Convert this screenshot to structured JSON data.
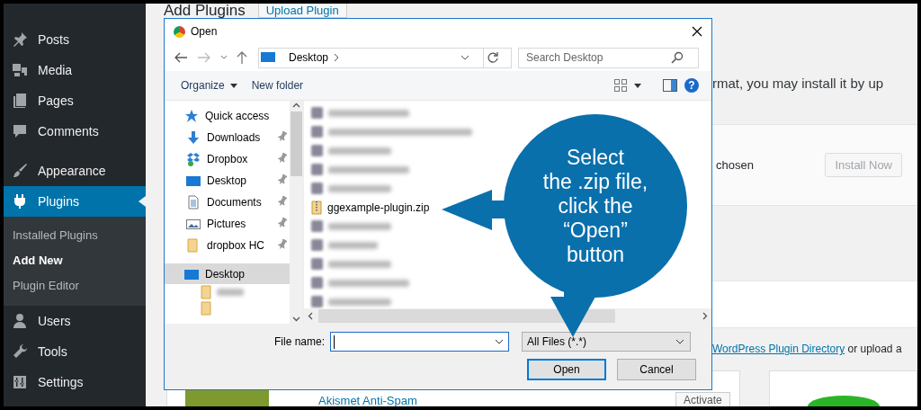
{
  "sidebar": {
    "groups": [
      [
        {
          "label": "Posts",
          "kind": "pin",
          "selected": false
        },
        {
          "label": "Media",
          "kind": "media",
          "selected": false
        },
        {
          "label": "Pages",
          "kind": "pages",
          "selected": false
        },
        {
          "label": "Comments",
          "kind": "comments",
          "selected": false
        }
      ],
      [
        {
          "label": "Appearance",
          "kind": "brush",
          "selected": false
        },
        {
          "label": "Plugins",
          "kind": "plug",
          "selected": true,
          "children": [
            {
              "label": "Installed Plugins",
              "selected": false
            },
            {
              "label": "Add New",
              "selected": true
            },
            {
              "label": "Plugin Editor",
              "selected": false
            }
          ]
        },
        {
          "label": "Users",
          "kind": "user",
          "selected": false
        },
        {
          "label": "Tools",
          "kind": "wrench",
          "selected": false
        },
        {
          "label": "Settings",
          "kind": "sliders",
          "selected": false
        }
      ]
    ]
  },
  "main": {
    "title": "Add Plugins",
    "upload_button": "Upload Plugin",
    "intro_fragment": "rmat, you may install it by up",
    "file_status": "chosen",
    "install_button": {
      "label": "Install Now",
      "disabled": true
    },
    "directory_link": "WordPress Plugin Directory",
    "directory_text": "or upload a",
    "plugin_card": {
      "name": "Akismet Anti-Spam",
      "action": "Activate"
    }
  },
  "dialog": {
    "title": "Open",
    "address": "Desktop",
    "search": {
      "placeholder": "Search Desktop"
    },
    "toolbar": {
      "organize": "Organize",
      "new_folder": "New folder",
      "help": "?"
    },
    "nav_items": [
      {
        "label": "Quick access",
        "kind": "star",
        "pinned": false,
        "selected": false
      },
      {
        "label": "Downloads",
        "kind": "download",
        "pinned": true,
        "selected": false
      },
      {
        "label": "Dropbox",
        "kind": "dropbox",
        "pinned": true,
        "selected": false
      },
      {
        "label": "Desktop",
        "kind": "desktop",
        "pinned": true,
        "selected": false
      },
      {
        "label": "Documents",
        "kind": "document",
        "pinned": true,
        "selected": false
      },
      {
        "label": "Pictures",
        "kind": "picture",
        "pinned": true,
        "selected": false
      },
      {
        "label": "dropbox HC",
        "kind": "folder",
        "pinned": true,
        "selected": false
      },
      {
        "label": "Desktop",
        "kind": "root",
        "pinned": false,
        "selected": true,
        "children": [
          {
            "kind": "blurred"
          },
          {
            "kind": "blurred"
          }
        ]
      }
    ],
    "files": [
      {
        "kind": "blurred"
      },
      {
        "kind": "blurred"
      },
      {
        "kind": "blurred"
      },
      {
        "kind": "blurred"
      },
      {
        "kind": "blurred"
      },
      {
        "kind": "zip",
        "name": "ggexample-plugin.zip"
      },
      {
        "kind": "blurred"
      },
      {
        "kind": "blurred"
      },
      {
        "kind": "blurred"
      },
      {
        "kind": "blurred"
      },
      {
        "kind": "blurred"
      }
    ],
    "file_name": {
      "label": "File name:",
      "focused": true
    },
    "file_type": "All Files (*.*)",
    "buttons": [
      {
        "label": "Open",
        "default": true
      },
      {
        "label": "Cancel",
        "default": false
      }
    ]
  },
  "callout": {
    "lines": [
      "Select",
      "the .zip file,",
      "click the",
      "“Open”",
      "button"
    ]
  }
}
